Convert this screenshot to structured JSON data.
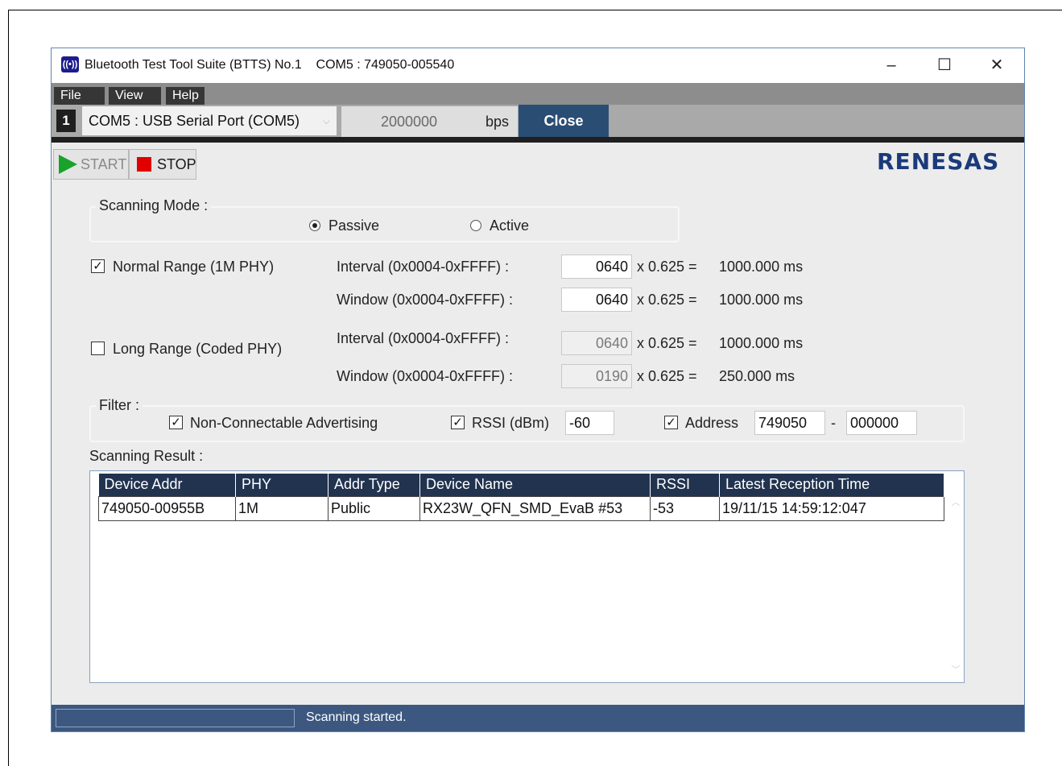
{
  "window": {
    "title": "Bluetooth Test Tool Suite (BTTS) No.1    COM5 : 749050-005540",
    "minimize_glyph": "–",
    "maximize_glyph": "☐",
    "close_glyph": "✕"
  },
  "menu": [
    "File",
    "View",
    "Help"
  ],
  "port": {
    "number": "1",
    "selected": "COM5 : USB Serial Port (COM5)",
    "baud": "2000000",
    "unit": "bps",
    "close_label": "Close"
  },
  "toolbar": {
    "start_label": "START",
    "stop_label": "STOP"
  },
  "logo_text": "RENESAS",
  "scanning_mode": {
    "label": "Scanning Mode :",
    "options": [
      "Passive",
      "Active"
    ],
    "selected": "Passive"
  },
  "normal_range": {
    "label": "Normal Range (1M PHY)",
    "checked": true,
    "interval_label": "Interval (0x0004-0xFFFF) :",
    "interval_value": "0640",
    "interval_result": "1000.000 ms",
    "window_label": "Window (0x0004-0xFFFF) :",
    "window_value": "0640",
    "window_result": "1000.000 ms",
    "multiplier": "x 0.625 ="
  },
  "long_range": {
    "label": "Long Range (Coded PHY)",
    "checked": false,
    "interval_label": "Interval (0x0004-0xFFFF) :",
    "interval_value": "0640",
    "interval_result": "1000.000 ms",
    "window_label": "Window (0x0004-0xFFFF) :",
    "window_value": "0190",
    "window_result": "250.000 ms",
    "multiplier": "x 0.625 ="
  },
  "filter": {
    "label": "Filter :",
    "non_connectable_label": "Non-Connectable Advertising",
    "rssi_label": "RSSI (dBm)",
    "rssi_value": "-60",
    "address_label": "Address",
    "address_part1": "749050",
    "address_sep": "-",
    "address_part2": "000000"
  },
  "result": {
    "label": "Scanning Result  :",
    "columns": [
      "Device Addr",
      "PHY",
      "Addr Type",
      "Device Name",
      "RSSI",
      "Latest Reception Time"
    ],
    "rows": [
      [
        "749050-00955B",
        "1M",
        "Public",
        "RX23W_QFN_SMD_EvaB #53",
        "-53",
        "19/11/15 14:59:12:047"
      ]
    ]
  },
  "status": {
    "text": "Scanning started."
  },
  "colors": {
    "accent": "#2a4d74",
    "status_bar": "#3c5880",
    "table_header": "#21334f",
    "start": "#1aa32a",
    "stop": "#e00000"
  }
}
